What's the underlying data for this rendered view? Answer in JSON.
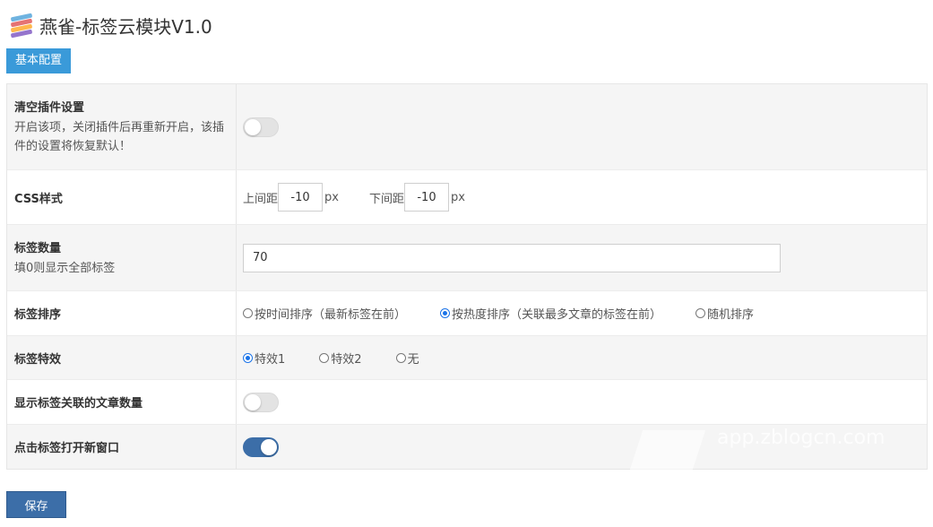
{
  "header": {
    "title": "燕雀-标签云模块V1.0",
    "logo_icon": "tag-stack-icon"
  },
  "tabs": {
    "basic": "基本配置"
  },
  "settings": {
    "reset": {
      "label": "清空插件设置",
      "desc": "开启该项，关闭插件后再重新开启，该插件的设置将恢复默认！",
      "enabled": false
    },
    "css": {
      "label": "CSS样式",
      "top_label": "上间距",
      "top_value": "-10",
      "bottom_label": "下间距",
      "bottom_value": "-10",
      "unit": "px"
    },
    "count": {
      "label": "标签数量",
      "desc": "填0则显示全部标签",
      "value": "70"
    },
    "sort": {
      "label": "标签排序",
      "options": [
        "按时间排序（最新标签在前）",
        "按热度排序（关联最多文章的标签在前）",
        "随机排序"
      ],
      "selected": 1
    },
    "effect": {
      "label": "标签特效",
      "options": [
        "特效1",
        "特效2",
        "无"
      ],
      "selected": 0
    },
    "show_count": {
      "label": "显示标签关联的文章数量",
      "enabled": false
    },
    "new_window": {
      "label": "点击标签打开新窗口",
      "enabled": true
    }
  },
  "footer": {
    "save_label": "保存"
  },
  "watermark": {
    "text": "app.zblogcn.com"
  },
  "colors": {
    "accent_blue": "#3a9ad9",
    "save_blue": "#3c6ea8",
    "toggle_on": "#3c6ea8"
  }
}
